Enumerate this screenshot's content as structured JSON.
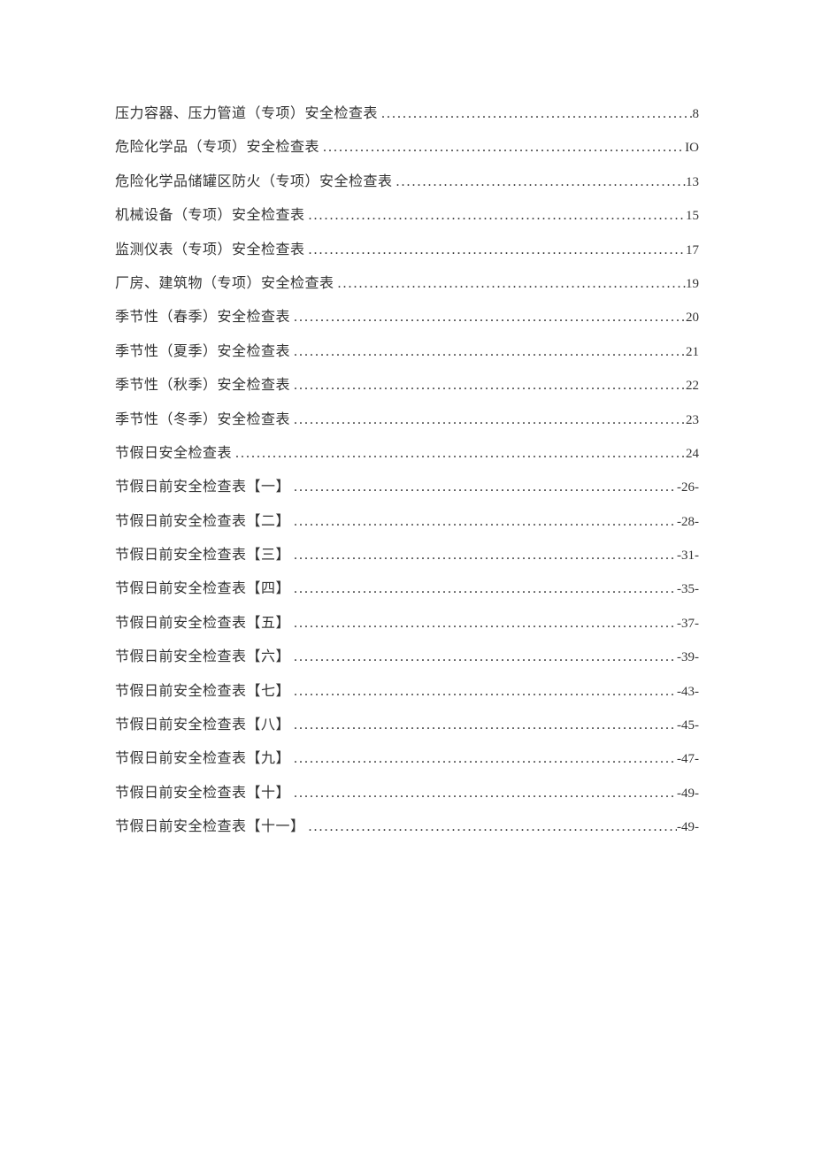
{
  "toc": {
    "entries": [
      {
        "title": "压力容器、压力管道（专项）安全检查表",
        "page": "8"
      },
      {
        "title": "危险化学品（专项）安全检查表",
        "page": "IO"
      },
      {
        "title": "危险化学品储罐区防火（专项）安全检查表",
        "page": "13"
      },
      {
        "title": "机械设备（专项）安全检查表",
        "page": "15"
      },
      {
        "title": "监测仪表（专项）安全检查表",
        "page": "17"
      },
      {
        "title": "厂房、建筑物（专项）安全检查表",
        "page": "19"
      },
      {
        "title": "季节性（春季）安全检查表",
        "page": "20"
      },
      {
        "title": "季节性（夏季）安全检查表",
        "page": "21"
      },
      {
        "title": "季节性（秋季）安全检查表",
        "page": "22"
      },
      {
        "title": "季节性（冬季）安全检查表",
        "page": "23"
      },
      {
        "title": "节假日安全检查表",
        "page": "24"
      },
      {
        "title": "节假日前安全检查表【一】",
        "page": "-26-"
      },
      {
        "title": "节假日前安全检查表【二】",
        "page": "-28-"
      },
      {
        "title": "节假日前安全检查表【三】",
        "page": "-31-"
      },
      {
        "title": "节假日前安全检查表【四】",
        "page": "-35-"
      },
      {
        "title": "节假日前安全检查表【五】",
        "page": "-37-"
      },
      {
        "title": "节假日前安全检查表【六】",
        "page": "-39-"
      },
      {
        "title": "节假日前安全检查表【七】",
        "page": "-43-"
      },
      {
        "title": "节假日前安全检查表【八】",
        "page": "-45-"
      },
      {
        "title": "节假日前安全检查表【九】",
        "page": "-47-"
      },
      {
        "title": "节假日前安全检查表【十】",
        "page": "-49-"
      },
      {
        "title": "节假日前安全检查表【十一】",
        "page": "-49-"
      }
    ]
  }
}
